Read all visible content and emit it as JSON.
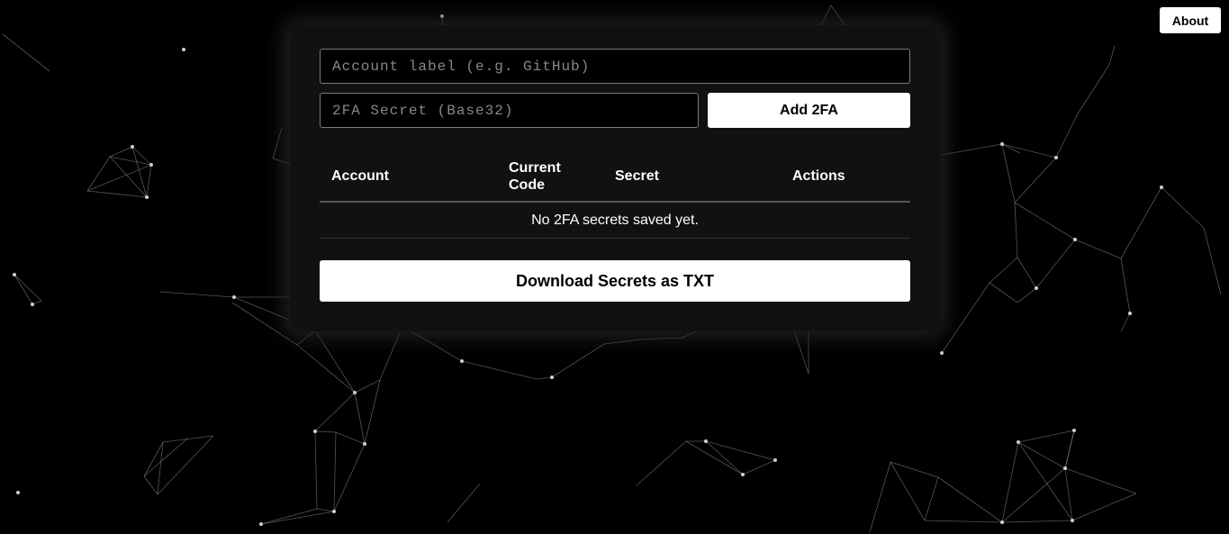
{
  "header": {
    "about_label": "About"
  },
  "form": {
    "account_placeholder": "Account label (e.g. GitHub)",
    "account_value": "",
    "secret_placeholder": "2FA Secret (Base32)",
    "secret_value": "",
    "add_label": "Add 2FA"
  },
  "table": {
    "columns": [
      "Account",
      "Current Code",
      "Secret",
      "Actions"
    ],
    "empty_message": "No 2FA secrets saved yet."
  },
  "download_label": "Download Secrets as TXT",
  "colors": {
    "background": "#000000",
    "panel": "#111111",
    "button": "#ffffff",
    "network_line": "#9a9a9a"
  }
}
